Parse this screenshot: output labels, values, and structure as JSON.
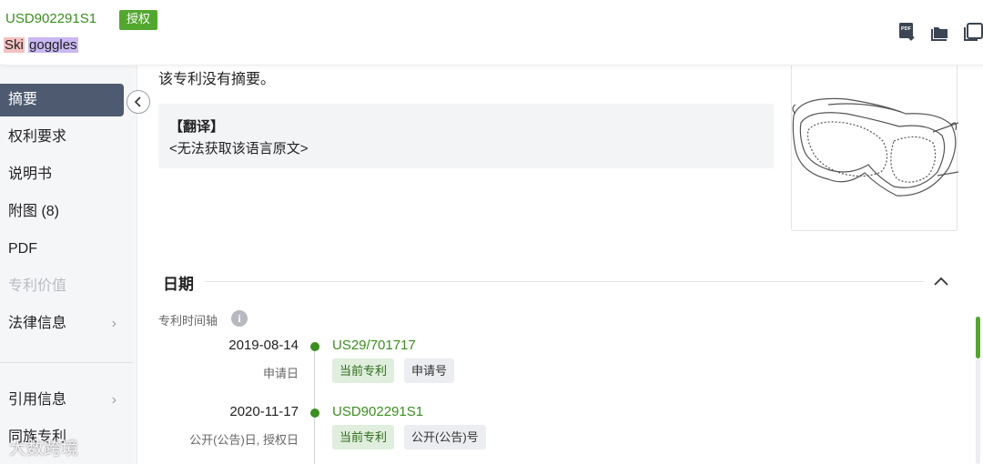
{
  "header": {
    "patent_number": "USD902291S1",
    "status": "授权",
    "title_words": [
      "Ski",
      "goggles"
    ]
  },
  "toolbar": {
    "icons": [
      "pdf-download-icon",
      "folder-icon",
      "copy-icon"
    ]
  },
  "sidebar": {
    "items": [
      {
        "label": "摘要",
        "active": true
      },
      {
        "label": "权利要求"
      },
      {
        "label": "说明书"
      },
      {
        "label": "附图 (8)"
      },
      {
        "label": "PDF"
      },
      {
        "label": "专利价值",
        "disabled": true
      },
      {
        "label": "法律信息",
        "chevron": true
      },
      {
        "label": "引用信息",
        "chevron": true
      },
      {
        "label": "同族专利"
      }
    ]
  },
  "abstract": {
    "no_abstract": "该专利没有摘要。",
    "translate_title": "【翻译】",
    "translate_text": "<无法获取该语言原文>"
  },
  "dates": {
    "section_title": "日期",
    "timeline_label": "专利时间轴",
    "events": [
      {
        "date": "2019-08-14",
        "label": "申请日",
        "number": "US29/701717",
        "tags": [
          "当前专利",
          "申请号"
        ]
      },
      {
        "date": "2020-11-17",
        "label": "公开(公告)日, 授权日",
        "number": "USD902291S1",
        "tags": [
          "当前专利",
          "公开(公告)号"
        ]
      }
    ]
  },
  "watermark": "大数跨境",
  "colors": {
    "brand_green": "#3a8f1f",
    "badge_green": "#52a72f",
    "active_nav": "#4d5a6f"
  }
}
